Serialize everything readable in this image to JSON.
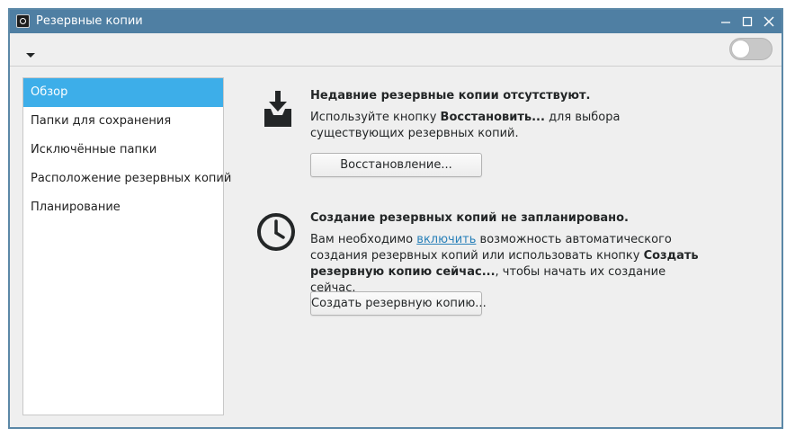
{
  "window": {
    "title": "Резервные копии"
  },
  "toolbar": {
    "menu_icon": "dropdown-arrow-icon",
    "toggle_state": "off"
  },
  "sidebar": {
    "items": [
      {
        "label": "Обзор",
        "active": true
      },
      {
        "label": "Папки для сохранения",
        "active": false
      },
      {
        "label": "Исключённые папки",
        "active": false
      },
      {
        "label": "Расположение резервных копий",
        "active": false
      },
      {
        "label": "Планирование",
        "active": false
      }
    ]
  },
  "restore_section": {
    "icon": "download-tray-icon",
    "heading": "Недавние резервные копии отсутствуют.",
    "text_before": "Используйте кнопку ",
    "text_bold": "Восстановить...",
    "text_after": " для выбора существующих резервных копий.",
    "button_label": "Восстановление..."
  },
  "schedule_section": {
    "icon": "clock-icon",
    "heading": "Создание резервных копий не запланировано.",
    "text_before": "Вам необходимо ",
    "link_text": "включить",
    "text_middle": " возможность автоматического создания резервных копий или использовать кнопку ",
    "text_bold": "Создать резервную копию сейчас...",
    "text_after": ", чтобы начать их создание сейчас.",
    "button_label": "Создать резервную копию..."
  },
  "colors": {
    "titlebar": "#4f7fa3",
    "selection": "#3daee9",
    "link": "#2980b9"
  }
}
